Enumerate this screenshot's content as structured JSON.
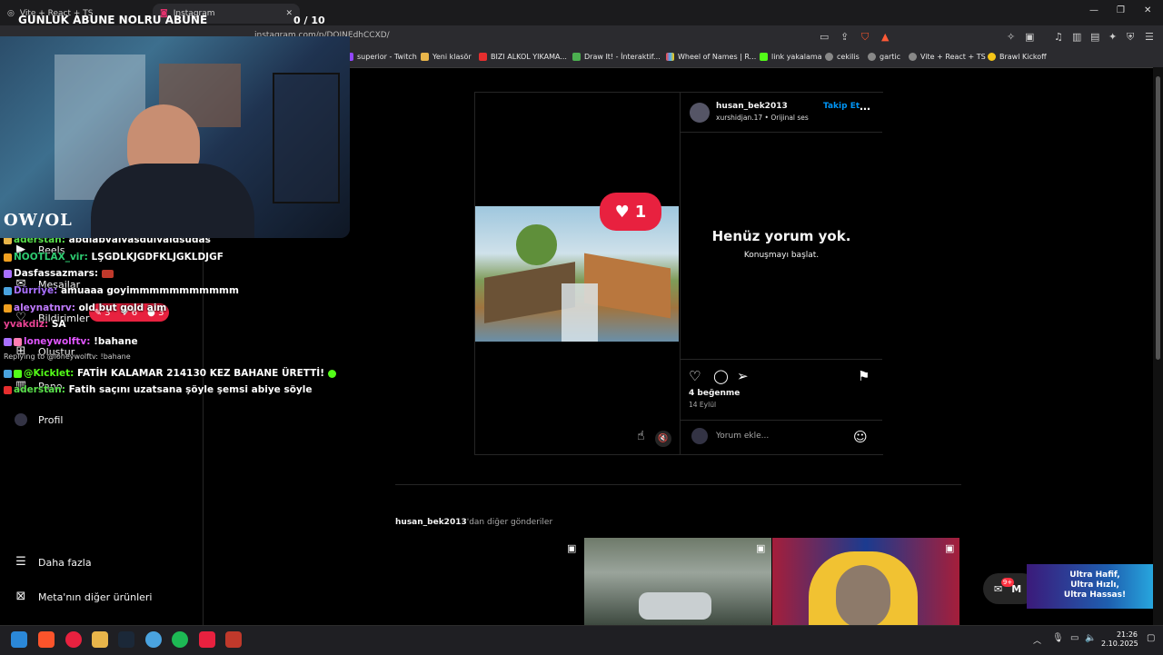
{
  "browser": {
    "tabs": [
      {
        "label": "Vite + React + TS"
      },
      {
        "label": "Instagram"
      }
    ],
    "url": "instagram.com/p/DOINEdhCCXD/",
    "bookmarks": [
      "superior - Twitch",
      "Yeni klasör",
      "BIZI ALKOL YIKAMA...",
      "Draw It! - İnteraktif...",
      "Wheel of Names | R...",
      "link yakalama",
      "cekilis",
      "gartic",
      "Vite + React + TS",
      "Brawl Kickoff"
    ]
  },
  "stream": {
    "title": "GUNLUK ABUNE NOLRU ABUNE",
    "counter": "0  / 10",
    "logo": "OW/OL"
  },
  "sidebar": {
    "items": [
      {
        "label": "Reels"
      },
      {
        "label": "Mesajlar"
      },
      {
        "label": "Bildirimler"
      },
      {
        "label": "Oluştur"
      },
      {
        "label": "Pano"
      },
      {
        "label": "Profil"
      }
    ],
    "more": "Daha fazla",
    "meta": "Meta'nın diğer ürünleri"
  },
  "notifications": {
    "comments": "3",
    "likes": "6",
    "follows": "3"
  },
  "chat": [
    {
      "user": "aderstan:",
      "text": "abdlabvalvasdulvaldsudas",
      "color": "#59e04b"
    },
    {
      "user": "NOOTLAX_vir:",
      "text": "LŞGDLKJGDFKLJGKLDJGF",
      "color": "#2ecc71"
    },
    {
      "user": "Dasfassazmars:",
      "text": "",
      "color": "#ffffff"
    },
    {
      "user": "Dürriye:",
      "text": "amuaaa goyimmmmmmmmmmm",
      "color": "#a970ff"
    },
    {
      "user": "aleynatnrv:",
      "text": "old but gold aim",
      "color": "#c07bff"
    },
    {
      "user": "yvakdiz:",
      "text": "SA",
      "color": "#e84393"
    },
    {
      "user": "loneywolftv:",
      "text": "!bahane",
      "color": "#e056fd"
    },
    {
      "user": "",
      "text": "Replying to @loneywolftv: !bahane",
      "color": "#cccccc"
    },
    {
      "user": "@Kicklet:",
      "text": "FATİH KALAMAR 214130 KEZ BAHANE ÜRETTİ!",
      "color": "#53fc18"
    },
    {
      "user": "aderstan:",
      "text": "Fatih saçını uzatsana şöyle şemsi abiye söyle",
      "color": "#59e04b"
    }
  ],
  "post": {
    "username": "husan_bek2013",
    "subline": "xurshidjan.17 • Orijinal ses",
    "follow": "Takip Et",
    "like_bubble": "1",
    "no_comments": "Henüz yorum yok.",
    "start_conversation": "Konuşmayı başlat.",
    "likes": "4 beğenme",
    "date": "14 Eylül",
    "comment_placeholder": "Yorum ekle..."
  },
  "more_posts": {
    "user": "husan_bek2013",
    "suffix": "'dan diğer gönderiler"
  },
  "messages_float": {
    "label": "M",
    "count": "9+"
  },
  "ad": {
    "line1": "Ultra Hafif,",
    "line2": "Ultra Hızlı,",
    "line3": "Ultra Hassas!"
  },
  "clock": {
    "time": "21:26",
    "date": "2.10.2025"
  },
  "colors": {
    "accent": "#0095f6",
    "like": "#e8213f"
  }
}
